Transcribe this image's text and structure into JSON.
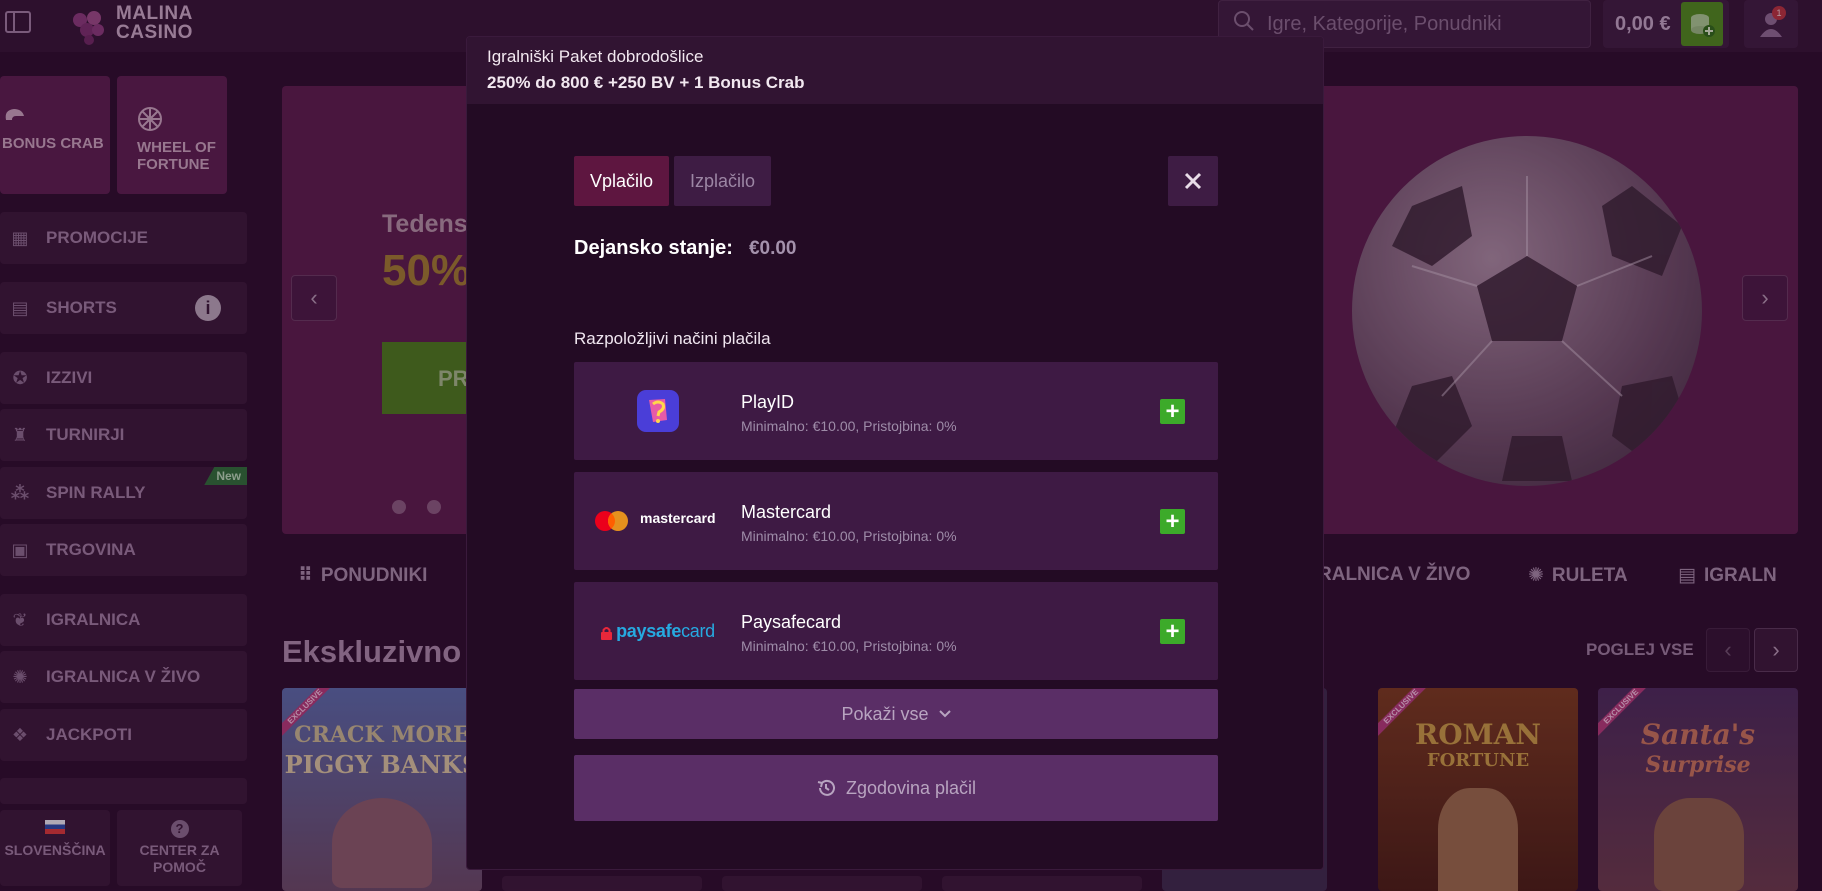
{
  "header": {
    "logo_line1": "MALINA",
    "logo_line2": "CASINO",
    "search_placeholder": "Igre, Kategorije, Ponudniki",
    "balance": "0,00 €",
    "notifications": "1"
  },
  "sidebar": {
    "tiles": [
      {
        "label": "BONUS CRAB"
      },
      {
        "label": "WHEEL OF FORTUNE"
      }
    ],
    "items": [
      {
        "label": "PROMOCIJE",
        "icon": "gift-icon"
      },
      {
        "label": "SHORTS",
        "icon": "film-icon"
      },
      {
        "label": "IZZIVI",
        "icon": "badge-icon"
      },
      {
        "label": "TURNIRJI",
        "icon": "trophy-icon"
      },
      {
        "label": "SPIN RALLY",
        "icon": "rally-icon",
        "tag": "New"
      },
      {
        "label": "TRGOVINA",
        "icon": "shop-icon"
      },
      {
        "label": "IGRALNICA",
        "icon": "cherries-icon"
      },
      {
        "label": "IGRALNICA V ŽIVO",
        "icon": "roulette-icon"
      },
      {
        "label": "JACKPOTI",
        "icon": "jackpot-icon"
      }
    ],
    "language": "SLOVENŠČINA",
    "help": "CENTER ZA POMOČ"
  },
  "hero": {
    "title": "Tedens",
    "percent": "50%",
    "cta": "PR"
  },
  "categories": [
    "PONUDNIKI",
    "RALNICA V ŽIVO",
    "RULETA",
    "IGRALN"
  ],
  "section": {
    "title": "Ekskluzivno",
    "see_all": "POGLEJ VSE"
  },
  "games": [
    {
      "title_line1": "CRACK MORE",
      "title_line2": "PIGGY BANKS",
      "tag": "EXCLUSIVE"
    },
    {
      "title_line1": "ROMAN",
      "title_line2": "FORTUNE",
      "tag": "EXCLUSIVE"
    },
    {
      "title_line1": "Santa's",
      "title_line2": "Surprise",
      "tag": "EXCLUSIVE"
    }
  ],
  "modal": {
    "promo_line1": "Igralniški Paket dobrodošlice",
    "promo_line2": "250% do 800 € +250 BV + 1 Bonus Crab",
    "tabs": {
      "deposit": "Vplačilo",
      "withdraw": "Izplačilo"
    },
    "balance_label": "Dejansko stanje:",
    "balance_value": "€0.00",
    "methods_title": "Razpoložljivi načini plačila",
    "methods": [
      {
        "name": "PlayID",
        "meta": "Minimalno: €10.00, Pristojbina: 0%",
        "logo": "playid-logo"
      },
      {
        "name": "Mastercard",
        "meta": "Minimalno: €10.00, Pristojbina: 0%",
        "logo": "mastercard-logo",
        "logo_text": "mastercard"
      },
      {
        "name": "Paysafecard",
        "meta": "Minimalno: €10.00, Pristojbina: 0%",
        "logo": "paysafecard-logo",
        "logo_text_a": "paysafe",
        "logo_text_b": "card"
      }
    ],
    "show_all": "Pokaži vse",
    "history": "Zgodovina plačil"
  }
}
